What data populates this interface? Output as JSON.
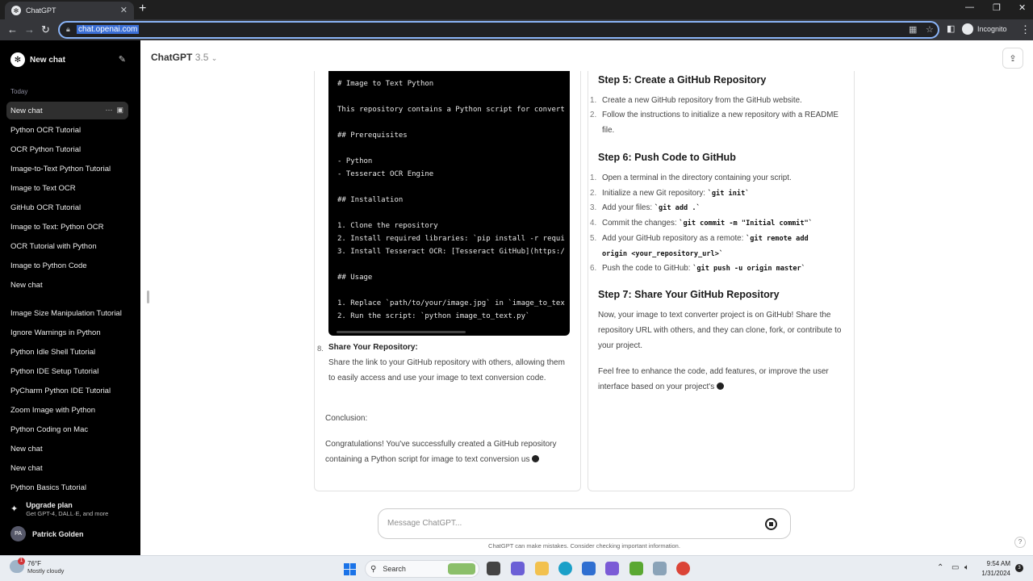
{
  "browser": {
    "tab_title": "ChatGPT",
    "url": "chat.openai.com",
    "profile_label": "Incognito",
    "icons": [
      "chatgpt-favicon",
      "close-icon",
      "plus-icon",
      "back-icon",
      "forward-icon",
      "reload-icon",
      "lock-icon",
      "qr-icon",
      "star-icon",
      "sidepanel-icon",
      "incognito-icon",
      "menu-icon"
    ]
  },
  "sidebar": {
    "new_chat_label": "New chat",
    "section_today": "Today",
    "items": [
      {
        "label": "New chat",
        "active": true
      },
      {
        "label": "Python OCR Tutorial"
      },
      {
        "label": "OCR Python Tutorial"
      },
      {
        "label": "Image-to-Text Python Tutorial"
      },
      {
        "label": "Image to Text OCR"
      },
      {
        "label": "GitHub OCR Tutorial"
      },
      {
        "label": "Image to Text: Python OCR"
      },
      {
        "label": "OCR Tutorial with Python"
      },
      {
        "label": "Image to Python Code"
      },
      {
        "label": "New chat"
      },
      {
        "label": "Image Size Manipulation Tutorial"
      },
      {
        "label": "Ignore Warnings in Python"
      },
      {
        "label": "Python Idle Shell Tutorial"
      },
      {
        "label": "Python IDE Setup Tutorial"
      },
      {
        "label": "PyCharm Python IDE Tutorial"
      },
      {
        "label": "Zoom Image with Python"
      },
      {
        "label": "Python Coding on Mac"
      },
      {
        "label": "New chat"
      },
      {
        "label": "New chat"
      },
      {
        "label": "Python Basics Tutorial"
      }
    ],
    "upgrade_title": "Upgrade plan",
    "upgrade_sub": "Get GPT-4, DALL·E, and more",
    "user_initials": "PA",
    "user_name": "Patrick Golden"
  },
  "header": {
    "model_name": "ChatGPT",
    "model_version": "3.5"
  },
  "left_panel": {
    "code_lines": [
      "# Image to Text Python",
      "This repository contains a Python script for convert",
      "## Prerequisites",
      "- Python",
      "- Tesseract OCR Engine",
      "## Installation",
      "1. Clone the repository",
      "2. Install required libraries: `pip install -r requi",
      "3. Install Tesseract OCR: [Tesseract GitHub](https:/",
      "## Usage",
      "1. Replace `path/to/your/image.jpg` in `image_to_tex",
      "2. Run the script: `python image_to_text.py`"
    ],
    "item8_number": "8.",
    "item8_title": "Share Your Repository:",
    "item8_text": "Share the link to your GitHub repository with others, allowing them to easily access and use your image to text conversion code.",
    "conclusion_label": "Conclusion:",
    "conclusion_text": "Congratulations! You've successfully created a GitHub repository containing a Python script for image to text conversion us"
  },
  "right_panel": {
    "step5_title": "Step 5: Create a GitHub Repository",
    "step5_items": [
      "Create a new GitHub repository from the GitHub website.",
      "Follow the instructions to initialize a new repository with a README file."
    ],
    "step6_title": "Step 6: Push Code to GitHub",
    "step6_items": {
      "i1": "Open a terminal in the directory containing your script.",
      "i2_text": "Initialize a new Git repository: ",
      "i2_code": "`git init`",
      "i3_text": "Add your files: ",
      "i3_code": "`git add .`",
      "i4_text": "Commit the changes: ",
      "i4_code": "`git commit -m \"Initial commit\"`",
      "i5_text": "Add your GitHub repository as a remote: ",
      "i5_code1": "`git remote add",
      "i5_code2": "origin <your_repository_url>`",
      "i6_text": "Push the code to GitHub: ",
      "i6_code": "`git push -u origin master`"
    },
    "step7_title": "Step 7: Share Your GitHub Repository",
    "step7_text": "Now, your image to text converter project is on GitHub! Share the repository URL with others, and they can clone, fork, or contribute to your project.",
    "closing_text": "Feel free to enhance the code, add features, or improve the user interface based on your project's"
  },
  "composer": {
    "placeholder": "Message ChatGPT...",
    "disclaimer": "ChatGPT can make mistakes. Consider checking important information.",
    "help_label": "?"
  },
  "taskbar": {
    "weather_badge": "1",
    "temperature": "76°F",
    "condition": "Mostly cloudy",
    "search_label": "Search",
    "time": "9:54 AM",
    "date": "1/31/2024",
    "notif_count": "3"
  }
}
